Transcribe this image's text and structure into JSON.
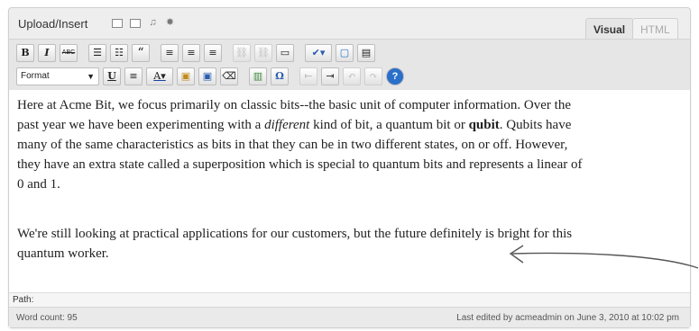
{
  "editor": {
    "upload_label": "Upload/Insert",
    "media_icons": [
      "image-icon",
      "video-icon",
      "audio-icon",
      "media-icon"
    ],
    "tabs": [
      {
        "label": "Visual",
        "active": true
      },
      {
        "label": "HTML",
        "active": false
      }
    ],
    "toolbar": {
      "row1": [
        {
          "icon": "bold-icon",
          "glyph": "B"
        },
        {
          "icon": "italic-icon",
          "glyph": "I"
        },
        {
          "icon": "strikethrough-icon",
          "glyph": "ABC"
        },
        {
          "icon": "bulleted-list-icon",
          "glyph": "☰"
        },
        {
          "icon": "numbered-list-icon",
          "glyph": "☷"
        },
        {
          "icon": "blockquote-icon",
          "glyph": "“"
        },
        {
          "icon": "align-left-icon",
          "glyph": "≡"
        },
        {
          "icon": "align-center-icon",
          "glyph": "≡"
        },
        {
          "icon": "align-right-icon",
          "glyph": "≡"
        },
        {
          "icon": "link-icon",
          "glyph": "⛓"
        },
        {
          "icon": "unlink-icon",
          "glyph": "⛓"
        },
        {
          "icon": "more-tag-icon",
          "glyph": "▭"
        },
        {
          "icon": "spellcheck-icon",
          "glyph": "✔"
        },
        {
          "icon": "fullscreen-icon",
          "glyph": "▢"
        },
        {
          "icon": "kitchen-sink-icon",
          "glyph": "▤"
        }
      ],
      "format_label": "Format",
      "row2": [
        {
          "icon": "underline-icon",
          "glyph": "U"
        },
        {
          "icon": "justify-icon",
          "glyph": "≡"
        },
        {
          "icon": "text-color-icon",
          "glyph": "A"
        },
        {
          "icon": "paste-text-icon",
          "glyph": "▣"
        },
        {
          "icon": "paste-word-icon",
          "glyph": "▣"
        },
        {
          "icon": "remove-format-icon",
          "glyph": "⌫"
        },
        {
          "icon": "insert-media-icon",
          "glyph": "▥"
        },
        {
          "icon": "special-character-icon",
          "glyph": "Ω"
        },
        {
          "icon": "outdent-icon",
          "glyph": "⇤"
        },
        {
          "icon": "indent-icon",
          "glyph": "⇥"
        },
        {
          "icon": "undo-icon",
          "glyph": "↶"
        },
        {
          "icon": "redo-icon",
          "glyph": "↷"
        },
        {
          "icon": "help-icon",
          "glyph": "?"
        }
      ]
    },
    "content": {
      "paragraph1_a": "Here at Acme Bit, we focus primarily on classic bits--the basic unit of computer information. Over the past year we have been experimenting with a ",
      "paragraph1_em": "different",
      "paragraph1_b": " kind of bit, a quantum bit or ",
      "paragraph1_strong": "qubit",
      "paragraph1_c": ". Qubits have many of the same characteristics as bits in that they can be in two different states, on or off. However, they have an extra state called a superposition which is special to quantum bits and represents a linear of 0 and 1.",
      "paragraph2": "We're still looking at practical applications for our customers, but the future definitely is bright for this quantum worker."
    },
    "path_label": "Path:",
    "word_count": "Word count: 95",
    "last_edited": "Last edited by acmeadmin on June 3, 2010 at 10:02 pm"
  }
}
